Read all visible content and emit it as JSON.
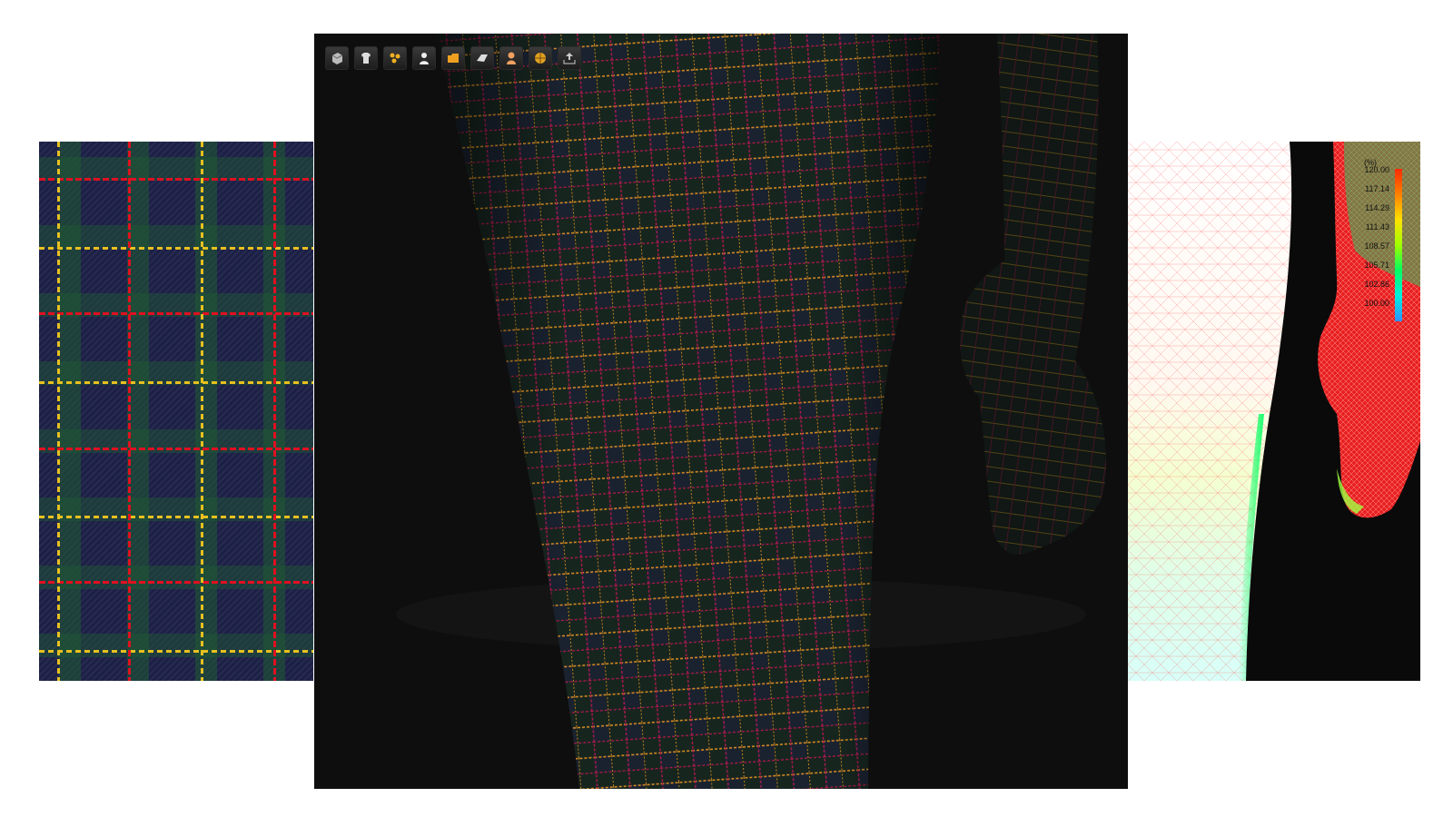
{
  "toolbar": {
    "buttons": [
      {
        "icon": "cube-icon"
      },
      {
        "icon": "garment-icon"
      },
      {
        "icon": "particles-icon"
      },
      {
        "icon": "avatar-icon"
      },
      {
        "icon": "folder-icon"
      },
      {
        "icon": "fabric-icon"
      },
      {
        "icon": "person-icon"
      },
      {
        "icon": "globe-icon"
      },
      {
        "icon": "export-icon"
      }
    ]
  },
  "strain_legend": {
    "unit": "(%)",
    "ticks": [
      "120.00",
      "117.14",
      "114.29",
      "111.43",
      "108.57",
      "105.71",
      "102.86",
      "100.00"
    ],
    "colors": [
      "#ff2a00",
      "#ffe000",
      "#00ff60",
      "#3090ff"
    ]
  },
  "colors": {
    "plaid_red": "#e01020",
    "plaid_yellow": "#e8c020",
    "plaid_navy": "#1c2046",
    "plaid_green": "#1e5a32",
    "viewport_bg": "#0e0e0e"
  }
}
